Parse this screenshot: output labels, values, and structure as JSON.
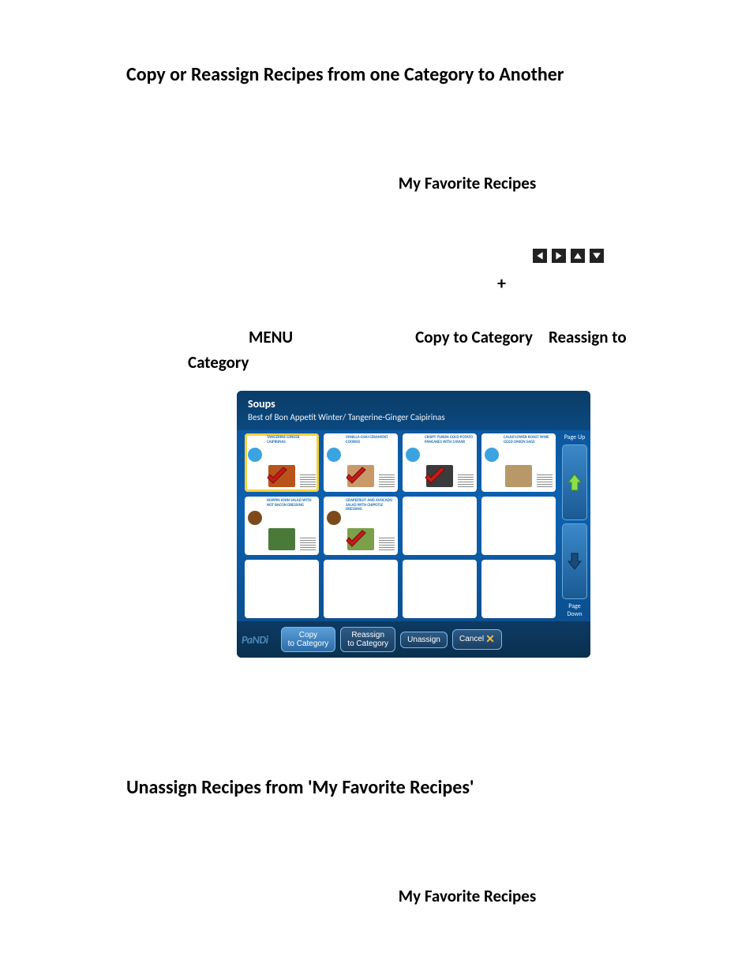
{
  "page": {
    "heading1": "Copy or Reassign Recipes from one Category to Another",
    "heading2": "Unassign Recipes from 'My Favorite Recipes'",
    "favoriteLabel": "My Favorite Recipes",
    "plus": "+",
    "menuLine": {
      "menu": "MENU",
      "copy": "Copy to Category",
      "reassignTo": "Reassign to",
      "category": "Category"
    }
  },
  "device": {
    "title": "Soups",
    "subtitle": "Best of Bon Appetit Winter/ Tangerine-Ginger Caipirinas",
    "brand": "PaNDi",
    "side": {
      "pageUp": "Page Up",
      "pageDown": "Page Down"
    },
    "buttons": {
      "copy": "Copy to Category",
      "reassign": "Reassign to Category",
      "unassign": "Unassign",
      "cancel": "Cancel"
    },
    "cards": [
      {
        "label": "TANGERINE-GINGER CAIPIRINAS",
        "checked": true,
        "selected": true,
        "badge": "blue",
        "thumb": "#b8541a"
      },
      {
        "label": "VANILLA CHAI CERAMENT COOKIES",
        "checked": true,
        "selected": false,
        "badge": "blue",
        "thumb": "#c89a6a"
      },
      {
        "label": "CRISPY YUKON GOLD POTATO PANCAKES WITH CAVIAR",
        "checked": true,
        "selected": false,
        "badge": "blue",
        "thumb": "#3b3b3b"
      },
      {
        "label": "CAULIFLOWER ROAST WINE GOLD ONION SAGE",
        "checked": false,
        "selected": false,
        "badge": "blue",
        "thumb": "#b89868"
      },
      {
        "label": "HOPPIN JOHN SALAD WITH HOT BACON DRESSING",
        "checked": false,
        "selected": false,
        "badge": "brown",
        "thumb": "#4a7a3a"
      },
      {
        "label": "GRAPEFRUIT AND AVOCADO SALAD WITH CHIPOTLE DRESSING",
        "checked": true,
        "selected": false,
        "badge": "brown",
        "thumb": "#7aa04a"
      },
      {
        "label": "",
        "checked": false,
        "selected": false,
        "badge": "",
        "thumb": ""
      },
      {
        "label": "",
        "checked": false,
        "selected": false,
        "badge": "",
        "thumb": ""
      },
      {
        "label": "",
        "checked": false,
        "selected": false,
        "badge": "",
        "thumb": ""
      },
      {
        "label": "",
        "checked": false,
        "selected": false,
        "badge": "",
        "thumb": ""
      },
      {
        "label": "",
        "checked": false,
        "selected": false,
        "badge": "",
        "thumb": ""
      },
      {
        "label": "",
        "checked": false,
        "selected": false,
        "badge": "",
        "thumb": ""
      }
    ]
  }
}
